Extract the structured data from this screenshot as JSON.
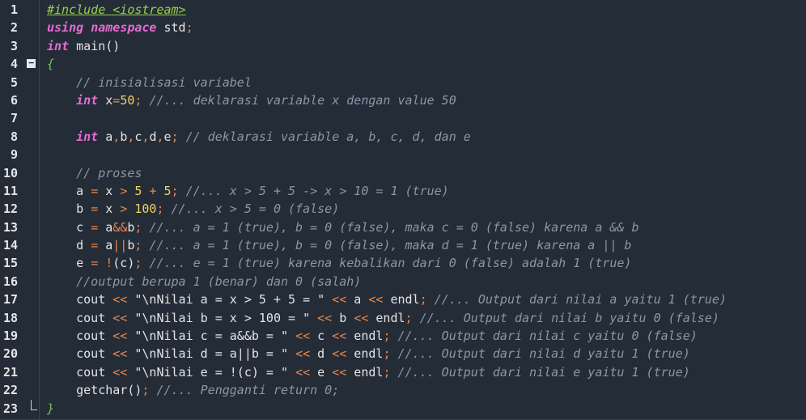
{
  "editor": {
    "line_numbers": [
      "1",
      "2",
      "3",
      "4",
      "5",
      "6",
      "7",
      "8",
      "9",
      "10",
      "11",
      "12",
      "13",
      "14",
      "15",
      "16",
      "17",
      "18",
      "19",
      "20",
      "21",
      "22",
      "23"
    ],
    "fold_open_symbol": "−",
    "lines": [
      [
        {
          "t": "#include <iostream>",
          "c": "pp"
        }
      ],
      [
        {
          "t": "using",
          "c": "kw"
        },
        {
          "t": " "
        },
        {
          "t": "namespace",
          "c": "kw"
        },
        {
          "t": " std"
        },
        {
          "t": ";",
          "c": "op"
        }
      ],
      [
        {
          "t": "int",
          "c": "kw"
        },
        {
          "t": " main()"
        }
      ],
      [
        {
          "t": "{",
          "c": "brace"
        }
      ],
      [
        {
          "t": "    "
        },
        {
          "t": "// inisialisasi variabel",
          "c": "cm"
        }
      ],
      [
        {
          "t": "    "
        },
        {
          "t": "int",
          "c": "kw"
        },
        {
          "t": " x"
        },
        {
          "t": "=",
          "c": "op"
        },
        {
          "t": "50",
          "c": "num"
        },
        {
          "t": ";",
          "c": "op"
        },
        {
          "t": " "
        },
        {
          "t": "//... deklarasi variable x dengan value 50",
          "c": "cm"
        }
      ],
      [],
      [
        {
          "t": "    "
        },
        {
          "t": "int",
          "c": "kw"
        },
        {
          "t": " a"
        },
        {
          "t": ",",
          "c": "op"
        },
        {
          "t": "b"
        },
        {
          "t": ",",
          "c": "op"
        },
        {
          "t": "c"
        },
        {
          "t": ",",
          "c": "op"
        },
        {
          "t": "d"
        },
        {
          "t": ",",
          "c": "op"
        },
        {
          "t": "e"
        },
        {
          "t": ";",
          "c": "op"
        },
        {
          "t": " "
        },
        {
          "t": "// deklarasi variable a, b, c, d, dan e",
          "c": "cm"
        }
      ],
      [],
      [
        {
          "t": "    "
        },
        {
          "t": "// proses",
          "c": "cm"
        }
      ],
      [
        {
          "t": "    a "
        },
        {
          "t": "=",
          "c": "op"
        },
        {
          "t": " x "
        },
        {
          "t": ">",
          "c": "op"
        },
        {
          "t": " "
        },
        {
          "t": "5",
          "c": "num"
        },
        {
          "t": " "
        },
        {
          "t": "+",
          "c": "op"
        },
        {
          "t": " "
        },
        {
          "t": "5",
          "c": "num"
        },
        {
          "t": ";",
          "c": "op"
        },
        {
          "t": " "
        },
        {
          "t": "//... x > 5 + 5 -> x > 10 = 1 (true)",
          "c": "cm"
        }
      ],
      [
        {
          "t": "    b "
        },
        {
          "t": "=",
          "c": "op"
        },
        {
          "t": " x "
        },
        {
          "t": ">",
          "c": "op"
        },
        {
          "t": " "
        },
        {
          "t": "100",
          "c": "num"
        },
        {
          "t": ";",
          "c": "op"
        },
        {
          "t": " "
        },
        {
          "t": "//... x > 5 = 0 (false)",
          "c": "cm"
        }
      ],
      [
        {
          "t": "    c "
        },
        {
          "t": "=",
          "c": "op"
        },
        {
          "t": " a"
        },
        {
          "t": "&&",
          "c": "op"
        },
        {
          "t": "b"
        },
        {
          "t": ";",
          "c": "op"
        },
        {
          "t": " "
        },
        {
          "t": "//... a = 1 (true), b = 0 (false), maka c = 0 (false) karena a && b",
          "c": "cm"
        }
      ],
      [
        {
          "t": "    d "
        },
        {
          "t": "=",
          "c": "op"
        },
        {
          "t": " a"
        },
        {
          "t": "||",
          "c": "op"
        },
        {
          "t": "b"
        },
        {
          "t": ";",
          "c": "op"
        },
        {
          "t": " "
        },
        {
          "t": "//... a = 1 (true), b = 0 (false), maka d = 1 (true) karena a || b",
          "c": "cm"
        }
      ],
      [
        {
          "t": "    e "
        },
        {
          "t": "=",
          "c": "op"
        },
        {
          "t": " "
        },
        {
          "t": "!",
          "c": "op"
        },
        {
          "t": "(c)"
        },
        {
          "t": ";",
          "c": "op"
        },
        {
          "t": " "
        },
        {
          "t": "//... e = 1 (true) karena kebalikan dari 0 (false) adalah 1 (true)",
          "c": "cm"
        }
      ],
      [
        {
          "t": "    "
        },
        {
          "t": "//output berupa 1 (benar) dan 0 (salah)",
          "c": "cm"
        }
      ],
      [
        {
          "t": "    cout "
        },
        {
          "t": "<<",
          "c": "op"
        },
        {
          "t": " \"\\nNilai a = x > 5 + 5 = \" "
        },
        {
          "t": "<<",
          "c": "op"
        },
        {
          "t": " a "
        },
        {
          "t": "<<",
          "c": "op"
        },
        {
          "t": " endl"
        },
        {
          "t": ";",
          "c": "op"
        },
        {
          "t": " "
        },
        {
          "t": "//... Output dari nilai a yaitu 1 (true)",
          "c": "cm"
        }
      ],
      [
        {
          "t": "    cout "
        },
        {
          "t": "<<",
          "c": "op"
        },
        {
          "t": " \"\\nNilai b = x > 100 = \" "
        },
        {
          "t": "<<",
          "c": "op"
        },
        {
          "t": " b "
        },
        {
          "t": "<<",
          "c": "op"
        },
        {
          "t": " endl"
        },
        {
          "t": ";",
          "c": "op"
        },
        {
          "t": " "
        },
        {
          "t": "//... Output dari nilai b yaitu 0 (false)",
          "c": "cm"
        }
      ],
      [
        {
          "t": "    cout "
        },
        {
          "t": "<<",
          "c": "op"
        },
        {
          "t": " \"\\nNilai c = a&&b = \" "
        },
        {
          "t": "<<",
          "c": "op"
        },
        {
          "t": " c "
        },
        {
          "t": "<<",
          "c": "op"
        },
        {
          "t": " endl"
        },
        {
          "t": ";",
          "c": "op"
        },
        {
          "t": " "
        },
        {
          "t": "//... Output dari nilai c yaitu 0 (false)",
          "c": "cm"
        }
      ],
      [
        {
          "t": "    cout "
        },
        {
          "t": "<<",
          "c": "op"
        },
        {
          "t": " \"\\nNilai d = a||b = \" "
        },
        {
          "t": "<<",
          "c": "op"
        },
        {
          "t": " d "
        },
        {
          "t": "<<",
          "c": "op"
        },
        {
          "t": " endl"
        },
        {
          "t": ";",
          "c": "op"
        },
        {
          "t": " "
        },
        {
          "t": "//... Output dari nilai d yaitu 1 (true)",
          "c": "cm"
        }
      ],
      [
        {
          "t": "    cout "
        },
        {
          "t": "<<",
          "c": "op"
        },
        {
          "t": " \"\\nNilai e = !(c) = \" "
        },
        {
          "t": "<<",
          "c": "op"
        },
        {
          "t": " e "
        },
        {
          "t": "<<",
          "c": "op"
        },
        {
          "t": " endl"
        },
        {
          "t": ";",
          "c": "op"
        },
        {
          "t": " "
        },
        {
          "t": "//... Output dari nilai e yaitu 1 (true)",
          "c": "cm"
        }
      ],
      [
        {
          "t": "    getchar()"
        },
        {
          "t": ";",
          "c": "op"
        },
        {
          "t": " "
        },
        {
          "t": "//... Pengganti return 0;",
          "c": "cm"
        }
      ],
      [
        {
          "t": "}",
          "c": "brace"
        }
      ]
    ]
  }
}
